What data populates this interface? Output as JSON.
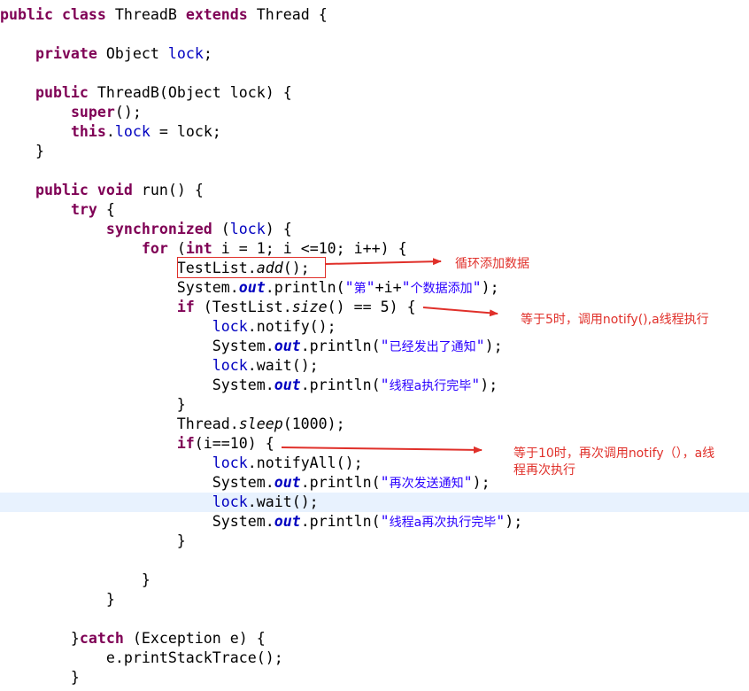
{
  "editor": {
    "highlight_line": 25,
    "lines": [
      [
        {
          "t": "public",
          "c": "kw"
        },
        {
          "t": " "
        },
        {
          "t": "class",
          "c": "kw"
        },
        {
          "t": " ThreadB "
        },
        {
          "t": "extends",
          "c": "kw"
        },
        {
          "t": " Thread {"
        }
      ],
      [],
      [
        {
          "t": "    "
        },
        {
          "t": "private",
          "c": "kw"
        },
        {
          "t": " Object "
        },
        {
          "t": "lock",
          "c": "fld"
        },
        {
          "t": ";"
        }
      ],
      [],
      [
        {
          "t": "    "
        },
        {
          "t": "public",
          "c": "kw"
        },
        {
          "t": " ThreadB(Object lock) {"
        }
      ],
      [
        {
          "t": "        "
        },
        {
          "t": "super",
          "c": "kw"
        },
        {
          "t": "();"
        }
      ],
      [
        {
          "t": "        "
        },
        {
          "t": "this",
          "c": "kw"
        },
        {
          "t": "."
        },
        {
          "t": "lock",
          "c": "fld"
        },
        {
          "t": " = lock;"
        }
      ],
      [
        {
          "t": "    }"
        }
      ],
      [],
      [
        {
          "t": "    "
        },
        {
          "t": "public",
          "c": "kw"
        },
        {
          "t": " "
        },
        {
          "t": "void",
          "c": "kw"
        },
        {
          "t": " run() {"
        }
      ],
      [
        {
          "t": "        "
        },
        {
          "t": "try",
          "c": "kw"
        },
        {
          "t": " {"
        }
      ],
      [
        {
          "t": "            "
        },
        {
          "t": "synchronized",
          "c": "kw"
        },
        {
          "t": " ("
        },
        {
          "t": "lock",
          "c": "fld"
        },
        {
          "t": ") {"
        }
      ],
      [
        {
          "t": "                "
        },
        {
          "t": "for",
          "c": "kw"
        },
        {
          "t": " ("
        },
        {
          "t": "int",
          "c": "kw"
        },
        {
          "t": " i = 1; i <=10; i++) {"
        }
      ],
      [
        {
          "t": "                    TestList."
        },
        {
          "t": "add",
          "c": "smeth"
        },
        {
          "t": "();"
        }
      ],
      [
        {
          "t": "                    System."
        },
        {
          "t": "out",
          "c": "sfld"
        },
        {
          "t": ".println("
        },
        {
          "t": "\"",
          "c": "str"
        },
        {
          "t": "第",
          "c": "str zh"
        },
        {
          "t": "\"",
          "c": "str"
        },
        {
          "t": "+i+"
        },
        {
          "t": "\"",
          "c": "str"
        },
        {
          "t": "个数据添加",
          "c": "str zh"
        },
        {
          "t": "\"",
          "c": "str"
        },
        {
          "t": ");"
        }
      ],
      [
        {
          "t": "                    "
        },
        {
          "t": "if",
          "c": "kw"
        },
        {
          "t": " (TestList."
        },
        {
          "t": "size",
          "c": "smeth"
        },
        {
          "t": "() == 5) {"
        }
      ],
      [
        {
          "t": "                        "
        },
        {
          "t": "lock",
          "c": "fld"
        },
        {
          "t": ".notify();"
        }
      ],
      [
        {
          "t": "                        System."
        },
        {
          "t": "out",
          "c": "sfld"
        },
        {
          "t": ".println("
        },
        {
          "t": "\"",
          "c": "str"
        },
        {
          "t": "已经发出了通知",
          "c": "str zh"
        },
        {
          "t": "\"",
          "c": "str"
        },
        {
          "t": ");"
        }
      ],
      [
        {
          "t": "                        "
        },
        {
          "t": "lock",
          "c": "fld"
        },
        {
          "t": ".wait();"
        }
      ],
      [
        {
          "t": "                        System."
        },
        {
          "t": "out",
          "c": "sfld"
        },
        {
          "t": ".println("
        },
        {
          "t": "\"",
          "c": "str"
        },
        {
          "t": "线程a执行完毕",
          "c": "str zh"
        },
        {
          "t": "\"",
          "c": "str"
        },
        {
          "t": ");"
        }
      ],
      [
        {
          "t": "                    }"
        }
      ],
      [
        {
          "t": "                    Thread."
        },
        {
          "t": "sleep",
          "c": "smeth"
        },
        {
          "t": "(1000);"
        }
      ],
      [
        {
          "t": "                    "
        },
        {
          "t": "if",
          "c": "kw"
        },
        {
          "t": "(i==10) {"
        }
      ],
      [
        {
          "t": "                        "
        },
        {
          "t": "lock",
          "c": "fld"
        },
        {
          "t": ".notifyAll();"
        }
      ],
      [
        {
          "t": "                        System."
        },
        {
          "t": "out",
          "c": "sfld"
        },
        {
          "t": ".println("
        },
        {
          "t": "\"",
          "c": "str"
        },
        {
          "t": "再次发送通知",
          "c": "str zh"
        },
        {
          "t": "\"",
          "c": "str"
        },
        {
          "t": ");"
        }
      ],
      [
        {
          "t": "                        "
        },
        {
          "t": "lock",
          "c": "fld"
        },
        {
          "t": ".wait();"
        }
      ],
      [
        {
          "t": "                        System."
        },
        {
          "t": "out",
          "c": "sfld"
        },
        {
          "t": ".println("
        },
        {
          "t": "\"",
          "c": "str"
        },
        {
          "t": "线程a再次执行完毕",
          "c": "str zh"
        },
        {
          "t": "\"",
          "c": "str"
        },
        {
          "t": ");"
        }
      ],
      [
        {
          "t": "                    }"
        }
      ],
      [],
      [
        {
          "t": "                }"
        }
      ],
      [
        {
          "t": "            }"
        }
      ],
      [],
      [
        {
          "t": "        }"
        },
        {
          "t": "catch",
          "c": "kw"
        },
        {
          "t": " (Exception e) {"
        }
      ],
      [
        {
          "t": "            e.printStackTrace();"
        }
      ],
      [
        {
          "t": "        }"
        }
      ]
    ]
  },
  "annotations": {
    "note1": "循环添加数据",
    "note2": "等于5时，调用notify(),a线程执行",
    "note3_line1": "等于10时，再次调用notify（），a线",
    "note3_line2": "程再次执行"
  },
  "colors": {
    "keyword": "#7f0055",
    "field": "#0000c0",
    "string": "#2a00ff",
    "annotation": "#e0302a",
    "current_line": "#e8f2fe"
  }
}
